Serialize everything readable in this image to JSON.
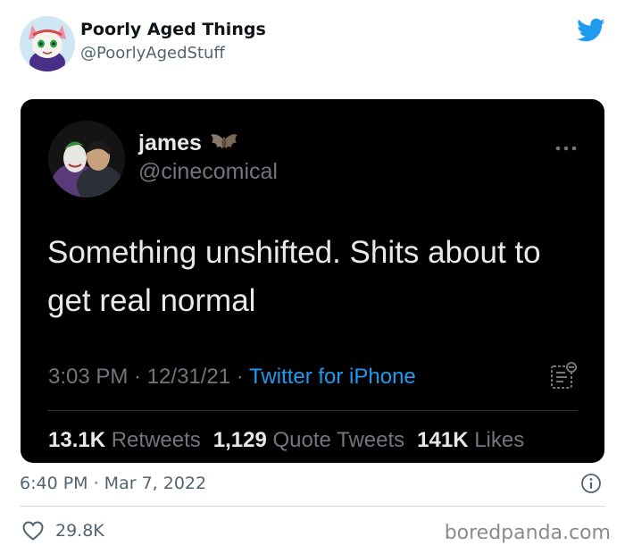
{
  "tweet": {
    "author_name": "Poorly Aged Things",
    "author_handle": "@PoorlyAgedStuff",
    "timestamp": "6:40 PM · Mar 7, 2022",
    "likes": "29.8K"
  },
  "embedded_tweet": {
    "name": "james",
    "handle": "@cinecomical",
    "text": "Something unshifted. Shits about to get real normal",
    "time": "3:03 PM · 12/31/21 · ",
    "source": "Twitter for iPhone",
    "retweets_count": "13.1K",
    "retweets_label": "Retweets",
    "quotes_count": "1,129",
    "quotes_label": "Quote Tweets",
    "likes_count": "141K",
    "likes_label": "Likes"
  },
  "watermark": "boredpanda.com",
  "colors": {
    "twitter_blue": "#1d9bf0",
    "dark_bg": "#000000",
    "secondary_text": "#536471"
  },
  "icons": [
    "twitter-bird-icon",
    "bat-icon",
    "more-icon",
    "notes-icon",
    "info-icon",
    "heart-icon"
  ]
}
